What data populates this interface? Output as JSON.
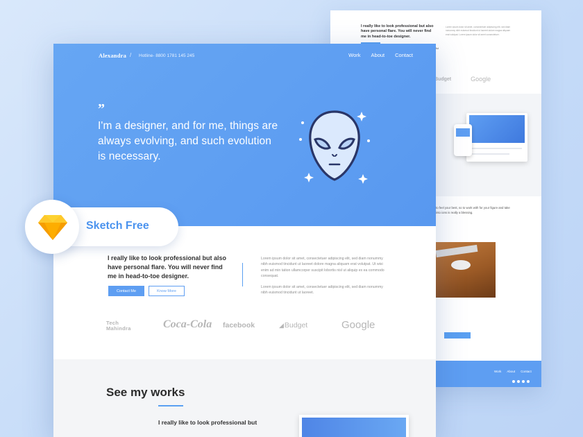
{
  "back_page": {
    "quote": "I really like to look professional but also have personal flare. You will never find me in head-to-toe designer.",
    "lorem": "Lorem ipsum dolor sit amet, consectetuer adipiscing elit, sed diam nonummy nibh euismod tincidunt ut laoreet dolore magna aliquam erat volutpat. Lorem ipsum dolor sit amet consectetuer.",
    "logos": [
      "Budget",
      "Google"
    ],
    "testimonial": "to feel your best, so to work with for your figure and take into ions is really a blessing.",
    "footer_nav": [
      "Work",
      "About",
      "Contact"
    ]
  },
  "header": {
    "brand": "Alexandra",
    "separator": "/",
    "hotline": "Hotline- 8800 1781 145 245",
    "nav": [
      "Work",
      "About",
      "Contact"
    ]
  },
  "hero": {
    "quote_mark": "”",
    "text": "I'm a designer, and for me, things are always evolving, and such evolution is necessary."
  },
  "intro": {
    "heading": "I really like to look professional but also have personal flare. You will never find me in head-to-toe designer.",
    "paragraph_1": "Lorem ipsum dolor sit amet, consectetuer adipiscing elit, sed diam nonummy nibh euismod tincidunt ut laoreet dolore magna aliquam erat volutpat. Ut wisi enim ad min tation ullamcorper suscipit lobortis nisl ut aliquip ex ea commodo consequat.",
    "paragraph_2": "Lorem ipsum dolor sit amet, consectetuer adipiscing elit, sed diam nonummy nibh euismod tincidunt ut laoreet.",
    "primary_button": "Contact Me",
    "secondary_button": "Know More"
  },
  "logos": {
    "tech_line1": "Tech",
    "tech_line2": "Mahindra",
    "cocacola": "Coca-Cola",
    "facebook": "facebook",
    "budget": "Budget",
    "google": "Google"
  },
  "works": {
    "title": "See my works",
    "subtitle": "I really like to look professional but"
  },
  "badge": {
    "label": "Sketch Free"
  },
  "colors": {
    "accent": "#5e9ef2",
    "background": "#c9ddf8",
    "sketch_gold": "#f7b500"
  }
}
